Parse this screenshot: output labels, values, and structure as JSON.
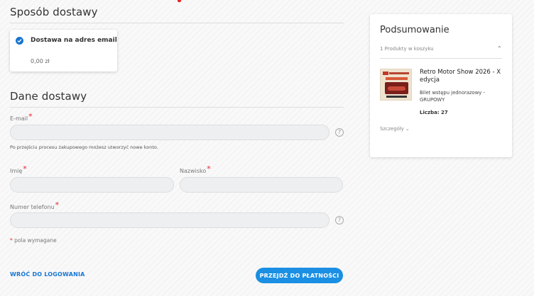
{
  "delivery": {
    "section_title": "Sposób dostawy",
    "option_name": "Dostawa na adres email",
    "option_price": "0,00 zł"
  },
  "shipping_data": {
    "section_title": "Dane dostawy",
    "email": {
      "label": "E-mail",
      "value": "",
      "hint": "Po przejściu procesu zakupowego możesz utworzyć nowe konto."
    },
    "first_name": {
      "label": "Imię",
      "value": ""
    },
    "last_name": {
      "label": "Nazwisko",
      "value": ""
    },
    "phone": {
      "label": "Numer telefonu",
      "value": ""
    },
    "required_star": "*",
    "help_icon_text": "?",
    "required_note": "pola wymagane"
  },
  "actions": {
    "back_label": "WRÓĆ DO LOGOWANIA",
    "next_label": "PRZEJDŹ DO PŁATNOŚCI"
  },
  "summary": {
    "title": "Podsumowanie",
    "count_text": "1 Produkty w koszyku",
    "product": {
      "name": "Retro Motor Show 2026 - X edycja",
      "description": "Bilet wstępu jednorazowy - GRUPOWY",
      "quantity_text": "Liczba: 27"
    },
    "details_label": "Szczegóły"
  },
  "icons": {
    "chevron_up": "chevron-up-icon",
    "chevron_down": "chevron-down-icon",
    "check": "check-circle-icon",
    "help": "help-icon"
  },
  "colors": {
    "accent": "#1a8fe3",
    "link": "#1976d2",
    "required": "#e8232a",
    "input_bg": "#eeeff1"
  }
}
